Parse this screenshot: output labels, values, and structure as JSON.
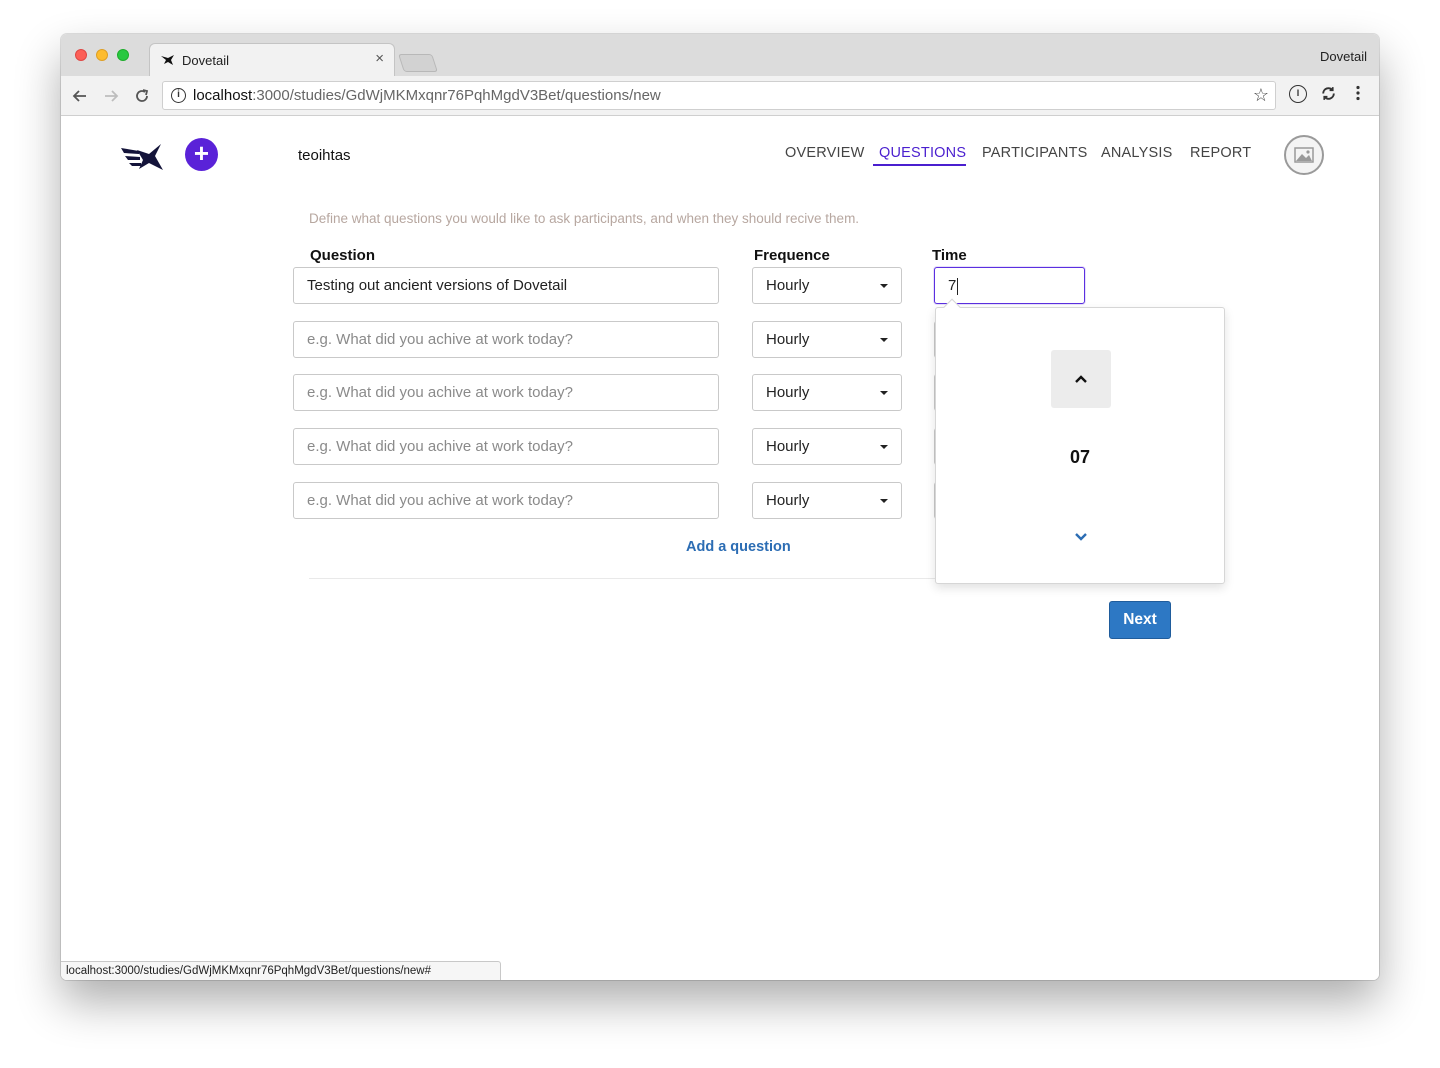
{
  "browser": {
    "tab_title": "Dovetail",
    "tab_close": "×",
    "window_label": "Dovetail",
    "url_host": "localhost",
    "url_path": ":3000/studies/GdWjMKMxqnr76PqhMgdV3Bet/questions/new",
    "status_url": "localhost:3000/studies/GdWjMKMxqnr76PqhMgdV3Bet/questions/new#",
    "nav_icons": [
      "back-arrow-icon",
      "forward-arrow-icon",
      "reload-icon"
    ],
    "toolbar_icons": [
      "star-icon",
      "onepassword-icon",
      "sync-icon",
      "kebab-menu-icon"
    ]
  },
  "header": {
    "add_symbol": "+",
    "study_name": "teoihtas",
    "nav": [
      {
        "label": "OVERVIEW",
        "active": false
      },
      {
        "label": "QUESTIONS",
        "active": true
      },
      {
        "label": "PARTICIPANTS",
        "active": false
      },
      {
        "label": "ANALYSIS",
        "active": false
      },
      {
        "label": "REPORT",
        "active": false
      }
    ],
    "accent_color": "#5a22d8"
  },
  "form": {
    "intro": "Define what questions you would like to ask participants, and when they should recive them.",
    "columns": {
      "question": "Question",
      "frequence": "Frequence",
      "time": "Time"
    },
    "rows": [
      {
        "question_value": "Testing out ancient versions of Dovetail",
        "placeholder": "",
        "frequence": "Hourly"
      },
      {
        "question_value": "",
        "placeholder": "e.g. What did you achive at work today?",
        "frequence": "Hourly"
      },
      {
        "question_value": "",
        "placeholder": "e.g. What did you achive at work today?",
        "frequence": "Hourly"
      },
      {
        "question_value": "",
        "placeholder": "e.g. What did you achive at work today?",
        "frequence": "Hourly"
      },
      {
        "question_value": "",
        "placeholder": "e.g. What did you achive at work today?",
        "frequence": "Hourly"
      }
    ],
    "time_value": "7",
    "time_picker": {
      "value": "07"
    },
    "add_question": "Add a question",
    "next": "Next",
    "button_color": "#2d78c4"
  }
}
